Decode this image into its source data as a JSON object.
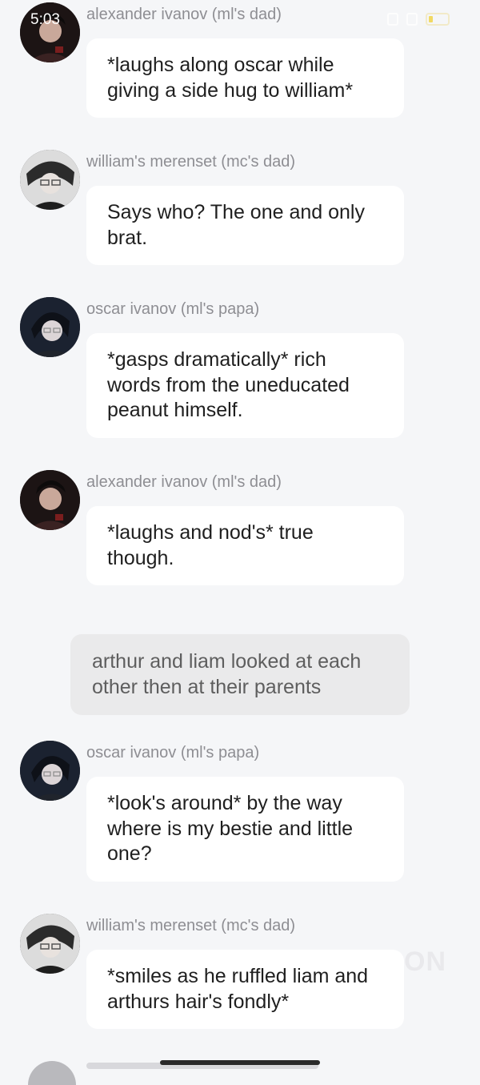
{
  "status_bar": {
    "time": "5:03"
  },
  "colors": {
    "background": "#f5f6f8",
    "bubble": "#ffffff",
    "narration_bubble": "#eaeaeb",
    "sender_text": "#8e8e93"
  },
  "messages": [
    {
      "sender": "alexander ivanov (ml's dad)",
      "text": "*laughs along oscar while giving a side hug to william*",
      "avatar": "alexander-avatar"
    },
    {
      "sender": "william's merenset (mc's dad)",
      "text": "Says who? The one and only brat.",
      "avatar": "william-avatar"
    },
    {
      "sender": "oscar ivanov (ml's papa)",
      "text": "*gasps dramatically* rich words from the uneducated peanut himself.",
      "avatar": "oscar-avatar"
    },
    {
      "sender": "alexander ivanov (ml's dad)",
      "text": "*laughs and nod's* true though.",
      "avatar": "alexander-avatar"
    },
    {
      "sender": "oscar ivanov (ml's papa)",
      "text": "*look's around* by the way where is my bestie and little one?",
      "avatar": "oscar-avatar"
    },
    {
      "sender": "william's merenset (mc's dad)",
      "text": "*smiles as he ruffled liam and arthurs hair's fondly*",
      "avatar": "william-avatar"
    }
  ],
  "narration": {
    "text": "arthur and liam looked at each other then at their parents"
  },
  "watermark": "ON"
}
